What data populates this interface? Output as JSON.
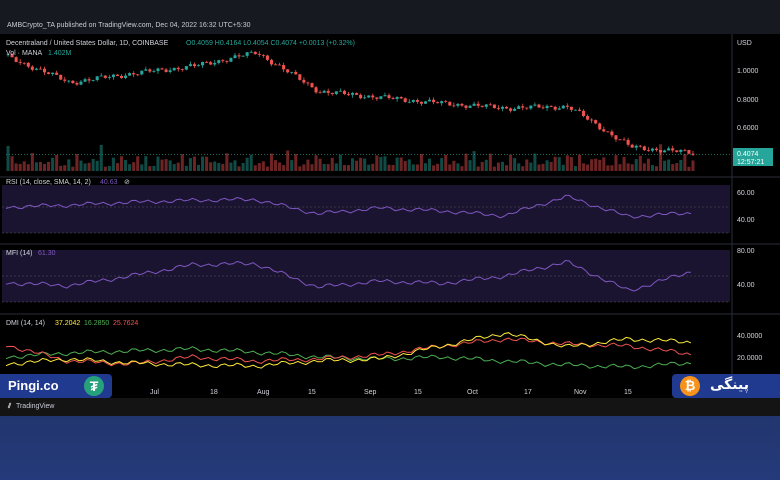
{
  "header": {
    "publish_line": "AMBCrypto_TA published on TradingView.com, Dec 04, 2022 16:32 UTC+5:30"
  },
  "price_pane": {
    "symbol": "Decentraland / United States Dollar, 1D, COINBASE",
    "ohlc": "O0.4059 H0.4164 L0.4054 C0.4074 +0.0013 (+0.32%)",
    "vol_label": "Vol · MANA",
    "vol_value": "1.402M",
    "currency": "USD",
    "last_price": "0.4074",
    "countdown": "12:57:21",
    "y_ticks": [
      "1.0000",
      "0.8000",
      "0.6000"
    ]
  },
  "rsi_pane": {
    "label": "RSI (14, close, SMA, 14, 2)",
    "value": "40.63",
    "y_ticks": [
      "60.00",
      "40.00"
    ]
  },
  "mfi_pane": {
    "label": "MFI (14)",
    "value": "61.30",
    "y_ticks": [
      "80.00",
      "40.00"
    ]
  },
  "dmi_pane": {
    "label": "DMI (14, 14)",
    "values": [
      "37.2042",
      "16.2850",
      "25.7624"
    ],
    "y_ticks": [
      "40.0000",
      "20.0000"
    ]
  },
  "x_axis": {
    "ticks": [
      "15",
      "Jul",
      "18",
      "Aug",
      "15",
      "Sep",
      "15",
      "Oct",
      "17",
      "Nov",
      "15"
    ]
  },
  "brand": {
    "left_name": "Pingi.co",
    "left_icon": "tether-icon",
    "right_name": "پینگی",
    "right_icon": "bitcoin-icon"
  },
  "footer": {
    "tv_label": "TradingView"
  },
  "colors": {
    "up": "#26a69a",
    "down": "#ef5350",
    "rsi": "#7e57c2",
    "mfi": "#7e57c2",
    "dmi_plus": "#4caf50",
    "dmi_minus": "#ef5350",
    "adx": "#ffeb3b"
  },
  "chart_data": [
    {
      "type": "line",
      "name_hint": "price-close-approx",
      "x": [
        "Jun 15",
        "Jul 1",
        "Jul 18",
        "Aug 1",
        "Aug 15",
        "Sep 1",
        "Sep 15",
        "Oct 1",
        "Oct 17",
        "Nov 1",
        "Nov 15",
        "Dec 4"
      ],
      "values": [
        1.05,
        0.88,
        0.94,
        0.99,
        1.08,
        0.82,
        0.78,
        0.74,
        0.71,
        0.72,
        0.45,
        0.41
      ],
      "ylim": [
        0.35,
        1.15
      ]
    },
    {
      "type": "line",
      "x": [
        "Jun 15",
        "Jul 1",
        "Jul 18",
        "Aug 1",
        "Aug 15",
        "Sep 1",
        "Sep 15",
        "Oct 1",
        "Oct 17",
        "Nov 1",
        "Nov 15",
        "Dec 4"
      ],
      "values": [
        47,
        49,
        52,
        54,
        55,
        40,
        46,
        43,
        38,
        58,
        37,
        41
      ],
      "ylim": [
        20,
        70
      ]
    },
    {
      "type": "line",
      "x": [
        "Jun 15",
        "Jul 1",
        "Jul 18",
        "Aug 1",
        "Aug 15",
        "Sep 1",
        "Sep 15",
        "Oct 1",
        "Oct 17",
        "Nov 1",
        "Nov 15",
        "Dec 4"
      ],
      "values": [
        46,
        42,
        55,
        70,
        72,
        40,
        48,
        45,
        55,
        74,
        35,
        61
      ],
      "ylim": [
        20,
        90
      ]
    },
    {
      "type": "line",
      "x": [
        "Jun 15",
        "Jul 1",
        "Jul 18",
        "Aug 1",
        "Aug 15",
        "Sep 1",
        "Sep 15",
        "Oct 1",
        "Oct 17",
        "Nov 1",
        "Nov 15",
        "Dec 4"
      ],
      "series": [
        {
          "values": [
            22,
            26,
            28,
            30,
            27,
            22,
            20,
            22,
            18,
            14,
            12,
            16
          ]
        },
        {
          "values": [
            34,
            18,
            15,
            22,
            18,
            20,
            24,
            33,
            40,
            35,
            33,
            25
          ]
        },
        {
          "values": [
            15,
            20,
            16,
            14,
            13,
            18,
            20,
            33,
            46,
            32,
            40,
            37
          ]
        }
      ],
      "ylim": [
        0,
        55
      ]
    }
  ]
}
